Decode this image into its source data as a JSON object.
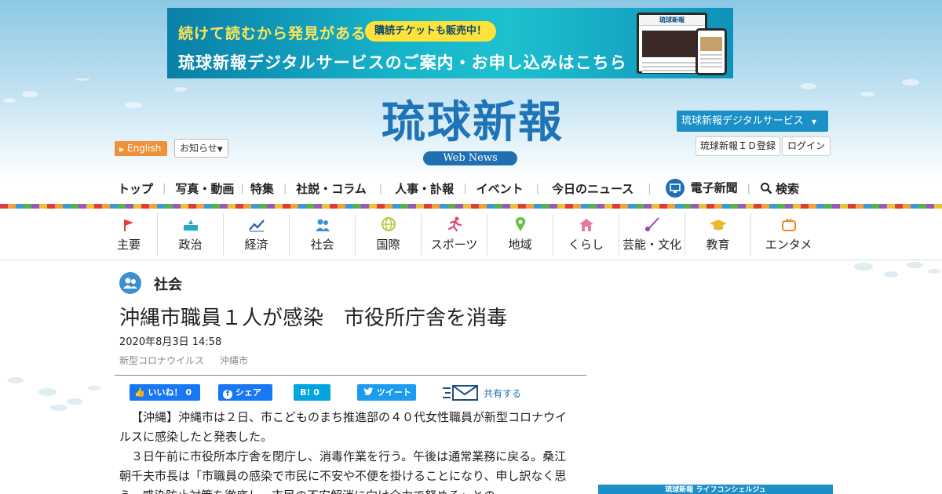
{
  "banner": {
    "line1": "続けて読むから発見がある",
    "badge": "購読チケットも販売中！",
    "line2": "琉球新報デジタルサービスのご案内・お申し込みはこちら",
    "device_title": "琉球新報"
  },
  "header": {
    "logo_title": "琉球新報",
    "logo_sub": "Web News",
    "english_label": "English",
    "notice_label": "お知らせ",
    "digital_label": "琉球新報デジタルサービス",
    "id_register_label": "琉球新報ＩＤ登録",
    "login_label": "ログイン"
  },
  "main_nav": {
    "items": [
      "トップ",
      "写真・動画",
      "特集",
      "社説・コラム",
      "人事・訃報",
      "イベント",
      "今日のニュース"
    ],
    "e_paper_label": "電子新聞",
    "search_label": "検索"
  },
  "categories": [
    {
      "label": "主要",
      "icon": "flag-icon",
      "color": "#e0413a"
    },
    {
      "label": "政治",
      "icon": "parliament-icon",
      "color": "#2aa6c9"
    },
    {
      "label": "経済",
      "icon": "chart-line-icon",
      "color": "#3557a8"
    },
    {
      "label": "社会",
      "icon": "people-icon",
      "color": "#3d8fd3"
    },
    {
      "label": "国際",
      "icon": "globe-icon",
      "color": "#b7c93a"
    },
    {
      "label": "スポーツ",
      "icon": "runner-icon",
      "color": "#e2456a"
    },
    {
      "label": "地域",
      "icon": "map-pin-icon",
      "color": "#6abf4b"
    },
    {
      "label": "くらし",
      "icon": "home-icon",
      "color": "#e77aa0"
    },
    {
      "label": "芸能・文化",
      "icon": "music-icon",
      "color": "#9b3fb3"
    },
    {
      "label": "教育",
      "icon": "graduation-cap-icon",
      "color": "#e8b830"
    },
    {
      "label": "エンタメ",
      "icon": "tv-icon",
      "color": "#f08a24"
    }
  ],
  "article": {
    "section": "社会",
    "title": "沖縄市職員１人が感染　市役所庁舎を消毒",
    "date": "2020年8月3日 14:58",
    "tags": [
      "新型コロナウイルス",
      "沖縄市"
    ],
    "paragraphs": [
      "【沖縄】沖縄市は２日、市こどものまち推進部の４０代女性職員が新型コロナウイルスに感染したと発表した。",
      "３日午前に市役所本庁舎を閉庁し、消毒作業を行う。午後は通常業務に戻る。桑江朝千夫市長は「市職員の感染で市民に不安や不便を掛けることになり、申し訳なく思う。感染防止対策を徹底し、市民の不安解消に向け全力で努める」との"
    ]
  },
  "share": {
    "like_label": "いいね！ 0",
    "facebook_label": "シェア",
    "hatena_label": "B! 0",
    "twitter_label": "ツイート",
    "more_label": "共有する"
  },
  "sidebar": {
    "concierge_label": "琉球新報 ライフコンシェルジュ"
  }
}
